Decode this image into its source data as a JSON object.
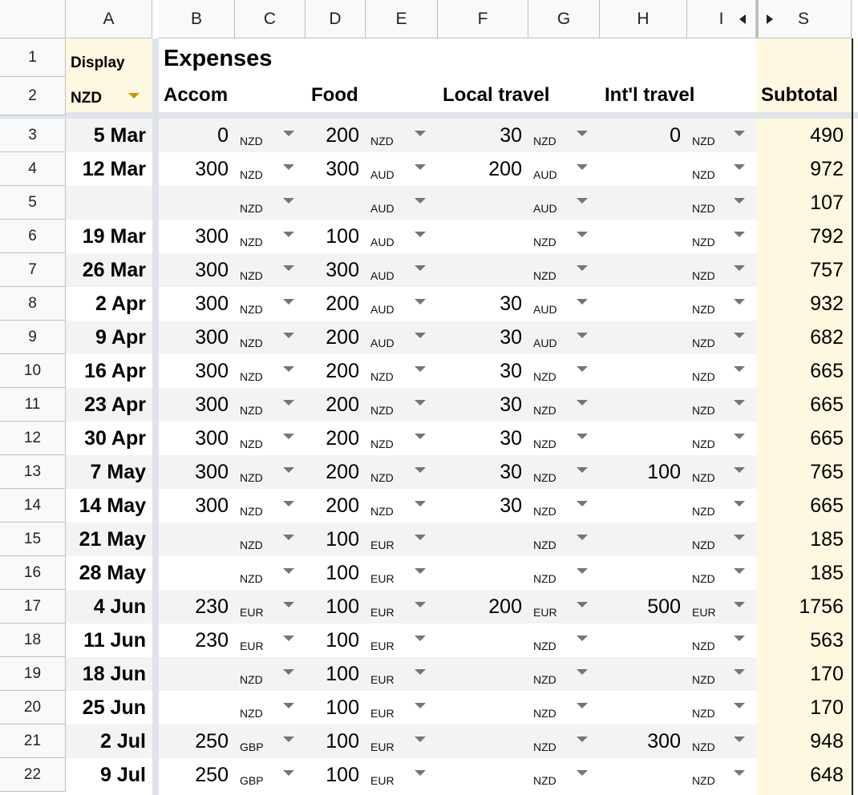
{
  "columns": [
    "A",
    "B",
    "C",
    "D",
    "E",
    "F",
    "G",
    "H",
    "I",
    "S"
  ],
  "scroll_left_icon": "triangle-left-icon",
  "scroll_right_icon": "triangle-right-icon",
  "header": {
    "display_label": "Display",
    "display_currency": "NZD",
    "title": "Expenses",
    "accom": "Accom",
    "food": "Food",
    "local_travel": "Local travel",
    "intl_travel": "Int'l travel",
    "subtotal": "Subtotal"
  },
  "colors": {
    "highlight": "#fff8e1",
    "band": "#f3f3f3",
    "freeze": "#dfe3ea"
  },
  "rows": [
    {
      "n": "3",
      "date": "5 Mar",
      "accom": "0",
      "accom_cur": "NZD",
      "food": "200",
      "food_cur": "NZD",
      "local": "30",
      "local_cur": "NZD",
      "intl": "0",
      "intl_cur": "NZD",
      "subtotal": "490"
    },
    {
      "n": "4",
      "date": "12 Mar",
      "accom": "300",
      "accom_cur": "NZD",
      "food": "300",
      "food_cur": "AUD",
      "local": "200",
      "local_cur": "AUD",
      "intl": "",
      "intl_cur": "NZD",
      "subtotal": "972"
    },
    {
      "n": "5",
      "date": "",
      "accom": "",
      "accom_cur": "NZD",
      "food": "",
      "food_cur": "AUD",
      "local": "",
      "local_cur": "AUD",
      "intl": "",
      "intl_cur": "NZD",
      "subtotal": "107"
    },
    {
      "n": "6",
      "date": "19 Mar",
      "accom": "300",
      "accom_cur": "NZD",
      "food": "100",
      "food_cur": "AUD",
      "local": "",
      "local_cur": "NZD",
      "intl": "",
      "intl_cur": "NZD",
      "subtotal": "792"
    },
    {
      "n": "7",
      "date": "26 Mar",
      "accom": "300",
      "accom_cur": "NZD",
      "food": "300",
      "food_cur": "AUD",
      "local": "",
      "local_cur": "NZD",
      "intl": "",
      "intl_cur": "NZD",
      "subtotal": "757"
    },
    {
      "n": "8",
      "date": "2 Apr",
      "accom": "300",
      "accom_cur": "NZD",
      "food": "200",
      "food_cur": "AUD",
      "local": "30",
      "local_cur": "AUD",
      "intl": "",
      "intl_cur": "NZD",
      "subtotal": "932"
    },
    {
      "n": "9",
      "date": "9 Apr",
      "accom": "300",
      "accom_cur": "NZD",
      "food": "200",
      "food_cur": "AUD",
      "local": "30",
      "local_cur": "AUD",
      "intl": "",
      "intl_cur": "NZD",
      "subtotal": "682"
    },
    {
      "n": "10",
      "date": "16 Apr",
      "accom": "300",
      "accom_cur": "NZD",
      "food": "200",
      "food_cur": "NZD",
      "local": "30",
      "local_cur": "NZD",
      "intl": "",
      "intl_cur": "NZD",
      "subtotal": "665"
    },
    {
      "n": "11",
      "date": "23 Apr",
      "accom": "300",
      "accom_cur": "NZD",
      "food": "200",
      "food_cur": "NZD",
      "local": "30",
      "local_cur": "NZD",
      "intl": "",
      "intl_cur": "NZD",
      "subtotal": "665"
    },
    {
      "n": "12",
      "date": "30 Apr",
      "accom": "300",
      "accom_cur": "NZD",
      "food": "200",
      "food_cur": "NZD",
      "local": "30",
      "local_cur": "NZD",
      "intl": "",
      "intl_cur": "NZD",
      "subtotal": "665"
    },
    {
      "n": "13",
      "date": "7 May",
      "accom": "300",
      "accom_cur": "NZD",
      "food": "200",
      "food_cur": "NZD",
      "local": "30",
      "local_cur": "NZD",
      "intl": "100",
      "intl_cur": "NZD",
      "subtotal": "765"
    },
    {
      "n": "14",
      "date": "14 May",
      "accom": "300",
      "accom_cur": "NZD",
      "food": "200",
      "food_cur": "NZD",
      "local": "30",
      "local_cur": "NZD",
      "intl": "",
      "intl_cur": "NZD",
      "subtotal": "665"
    },
    {
      "n": "15",
      "date": "21 May",
      "accom": "",
      "accom_cur": "NZD",
      "food": "100",
      "food_cur": "EUR",
      "local": "",
      "local_cur": "NZD",
      "intl": "",
      "intl_cur": "NZD",
      "subtotal": "185"
    },
    {
      "n": "16",
      "date": "28 May",
      "accom": "",
      "accom_cur": "NZD",
      "food": "100",
      "food_cur": "EUR",
      "local": "",
      "local_cur": "NZD",
      "intl": "",
      "intl_cur": "NZD",
      "subtotal": "185"
    },
    {
      "n": "17",
      "date": "4 Jun",
      "accom": "230",
      "accom_cur": "EUR",
      "food": "100",
      "food_cur": "EUR",
      "local": "200",
      "local_cur": "EUR",
      "intl": "500",
      "intl_cur": "EUR",
      "subtotal": "1756"
    },
    {
      "n": "18",
      "date": "11 Jun",
      "accom": "230",
      "accom_cur": "EUR",
      "food": "100",
      "food_cur": "EUR",
      "local": "",
      "local_cur": "NZD",
      "intl": "",
      "intl_cur": "NZD",
      "subtotal": "563"
    },
    {
      "n": "19",
      "date": "18 Jun",
      "accom": "",
      "accom_cur": "NZD",
      "food": "100",
      "food_cur": "EUR",
      "local": "",
      "local_cur": "NZD",
      "intl": "",
      "intl_cur": "NZD",
      "subtotal": "170"
    },
    {
      "n": "20",
      "date": "25 Jun",
      "accom": "",
      "accom_cur": "NZD",
      "food": "100",
      "food_cur": "EUR",
      "local": "",
      "local_cur": "NZD",
      "intl": "",
      "intl_cur": "NZD",
      "subtotal": "170"
    },
    {
      "n": "21",
      "date": "2 Jul",
      "accom": "250",
      "accom_cur": "GBP",
      "food": "100",
      "food_cur": "EUR",
      "local": "",
      "local_cur": "NZD",
      "intl": "300",
      "intl_cur": "NZD",
      "subtotal": "948"
    },
    {
      "n": "22",
      "date": "9 Jul",
      "accom": "250",
      "accom_cur": "GBP",
      "food": "100",
      "food_cur": "EUR",
      "local": "",
      "local_cur": "NZD",
      "intl": "",
      "intl_cur": "NZD",
      "subtotal": "648"
    }
  ]
}
